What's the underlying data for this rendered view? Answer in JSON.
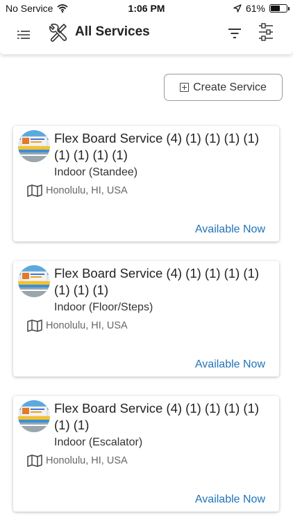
{
  "status": {
    "carrier": "No Service",
    "time": "1:06 PM",
    "battery_text": "61%",
    "battery_level": 0.61
  },
  "header": {
    "title": "All Services",
    "menu_icon": "menu-icon",
    "title_icon": "tools-icon",
    "filter_icon": "filter-icon",
    "settings_icon": "sliders-icon"
  },
  "actions": {
    "create_label": "Create Service"
  },
  "services": [
    {
      "title": "Flex Board Service (4) (1) (1) (1) (1) (1) (1) (1) (1)",
      "type": "Indoor (Standee)",
      "location": "Honolulu, HI, USA",
      "availability": "Available Now"
    },
    {
      "title": "Flex Board Service (4) (1) (1) (1) (1) (1) (1) (1)",
      "type": "Indoor (Floor/Steps)",
      "location": "Honolulu, HI, USA",
      "availability": "Available Now"
    },
    {
      "title": "Flex Board Service (4) (1) (1) (1) (1) (1) (1)",
      "type": "Indoor (Escalator)",
      "location": "Honolulu, HI, USA",
      "availability": "Available Now"
    }
  ],
  "colors": {
    "link": "#1f73b7"
  }
}
